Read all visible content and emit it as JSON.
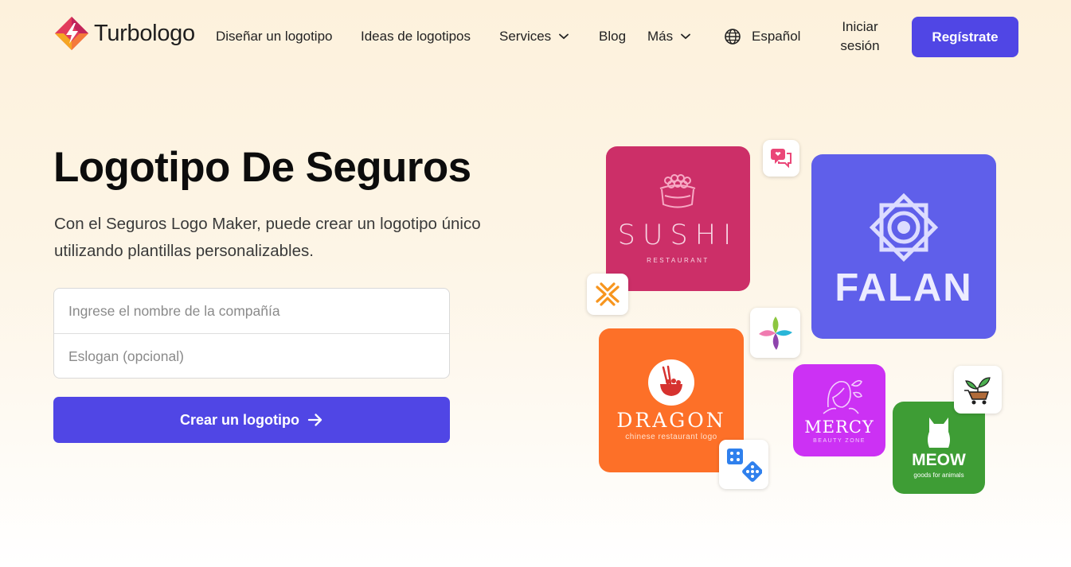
{
  "header": {
    "brand": "Turbologo",
    "nav": [
      {
        "label": "Diseñar un logotipo"
      },
      {
        "label": "Ideas de logotipos"
      },
      {
        "label": "Services"
      },
      {
        "label": "Blog"
      },
      {
        "label": "Más"
      }
    ],
    "language": "Español",
    "login_line1": "Iniciar",
    "login_line2": "sesión",
    "register": "Regístrate"
  },
  "hero": {
    "title": "Logotipo De Seguros",
    "subtitle": "Con el Seguros Logo Maker, puede crear un logotipo único utilizando plantillas personalizables.",
    "company_placeholder": "Ingrese el nombre de la compañía",
    "slogan_placeholder": "Eslogan (opcional)",
    "cta": "Crear un logotipo"
  },
  "collage": {
    "sushi": {
      "name": "SUSHI",
      "tagline": "RESTAURANT",
      "color": "#cc2f68"
    },
    "falan": {
      "name": "FALAN",
      "color": "#5f5fea"
    },
    "dragon": {
      "name": "DRAGON",
      "tagline": "chinese restaurant logo",
      "color": "#fd7028"
    },
    "mercy": {
      "name": "MERCY",
      "tagline": "BEAUTY ZONE",
      "color": "#cc31f4"
    },
    "meow": {
      "name": "MEOW",
      "tagline": "goods for animals",
      "color": "#3e9d35"
    }
  },
  "colors": {
    "accent": "#5046e5",
    "background_top": "#fdf1dc"
  },
  "icons": [
    "brand-logo-icon",
    "chevron-down-icon",
    "globe-icon",
    "arrow-right-icon",
    "chat-heart-icon",
    "arrows-x-icon",
    "petal-flower-icon",
    "dice-icon",
    "plant-cart-icon"
  ]
}
